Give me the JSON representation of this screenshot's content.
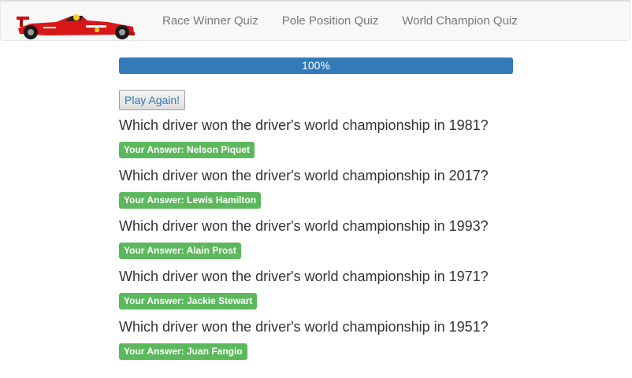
{
  "navbar": {
    "links": [
      {
        "label": "Race Winner Quiz"
      },
      {
        "label": "Pole Position Quiz"
      },
      {
        "label": "World Champion Quiz"
      }
    ]
  },
  "progress": {
    "value_percent": 100,
    "label": "100%",
    "color": "#337ab7"
  },
  "play_again_label": "Play Again!",
  "answer_badge_color": "#5cb85c",
  "questions": [
    {
      "text": "Which driver won the driver's world championship in 1981?",
      "answer": "Your Answer: Nelson Piquet"
    },
    {
      "text": "Which driver won the driver's world championship in 2017?",
      "answer": "Your Answer: Lewis Hamilton"
    },
    {
      "text": "Which driver won the driver's world championship in 1993?",
      "answer": "Your Answer: Alain Prost"
    },
    {
      "text": "Which driver won the driver's world championship in 1971?",
      "answer": "Your Answer: Jackie Stewart"
    },
    {
      "text": "Which driver won the driver's world championship in 1951?",
      "answer": "Your Answer: Juan Fangio"
    }
  ]
}
